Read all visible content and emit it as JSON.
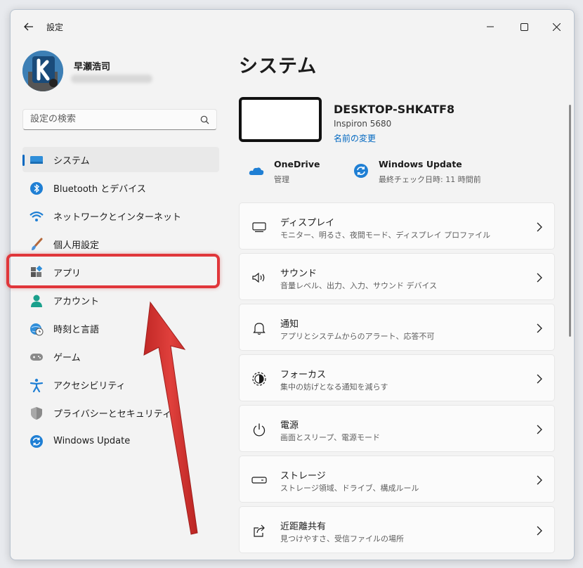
{
  "window": {
    "title": "設定"
  },
  "profile": {
    "name": "早瀬浩司"
  },
  "search": {
    "placeholder": "設定の検索"
  },
  "nav": {
    "items": [
      {
        "label": "システム",
        "icon": "system-icon"
      },
      {
        "label": "Bluetooth とデバイス",
        "icon": "bluetooth-icon"
      },
      {
        "label": "ネットワークとインターネット",
        "icon": "wifi-icon"
      },
      {
        "label": "個人用設定",
        "icon": "brush-icon"
      },
      {
        "label": "アプリ",
        "icon": "apps-icon"
      },
      {
        "label": "アカウント",
        "icon": "account-icon"
      },
      {
        "label": "時刻と言語",
        "icon": "globe-clock-icon"
      },
      {
        "label": "ゲーム",
        "icon": "gamepad-icon"
      },
      {
        "label": "アクセシビリティ",
        "icon": "accessibility-icon"
      },
      {
        "label": "プライバシーとセキュリティ",
        "icon": "shield-icon"
      },
      {
        "label": "Windows Update",
        "icon": "update-icon"
      }
    ],
    "selected_index": 0
  },
  "main": {
    "title": "システム",
    "device": {
      "name": "DESKTOP-SHKATF8",
      "model": "Inspiron 5680",
      "rename": "名前の変更"
    },
    "quick": [
      {
        "title": "OneDrive",
        "subtitle": "管理",
        "icon": "onedrive-icon"
      },
      {
        "title": "Windows Update",
        "subtitle": "最終チェック日時: 11 時間前",
        "icon": "update-icon"
      }
    ],
    "cards": [
      {
        "title": "ディスプレイ",
        "subtitle": "モニター、明るさ、夜間モード、ディスプレイ プロファイル",
        "icon": "display-icon"
      },
      {
        "title": "サウンド",
        "subtitle": "音量レベル、出力、入力、サウンド デバイス",
        "icon": "speaker-icon"
      },
      {
        "title": "通知",
        "subtitle": "アプリとシステムからのアラート、応答不可",
        "icon": "bell-icon"
      },
      {
        "title": "フォーカス",
        "subtitle": "集中の妨げとなる通知を減らす",
        "icon": "focus-icon"
      },
      {
        "title": "電源",
        "subtitle": "画面とスリープ、電源モード",
        "icon": "power-icon"
      },
      {
        "title": "ストレージ",
        "subtitle": "ストレージ領域、ドライブ、構成ルール",
        "icon": "storage-icon"
      },
      {
        "title": "近距離共有",
        "subtitle": "見つけやすさ、受信ファイルの場所",
        "icon": "share-icon"
      }
    ]
  },
  "colors": {
    "accent": "#0067c0",
    "highlight": "#e0363a",
    "arrow": "#d8302f"
  }
}
